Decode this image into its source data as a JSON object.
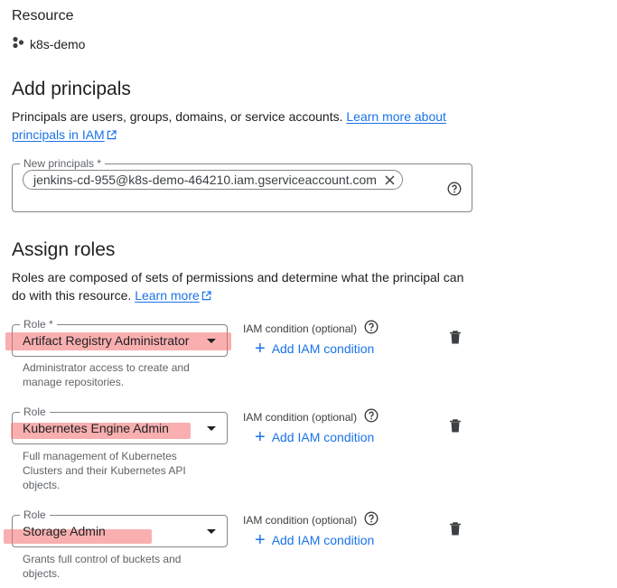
{
  "resource": {
    "heading": "Resource",
    "name": "k8s-demo",
    "icon": "project-nodes-icon"
  },
  "principals": {
    "heading": "Add principals",
    "desc_text": "Principals are users, groups, domains, or service accounts.",
    "desc_link_part1": "Learn more about",
    "desc_link_part2": "principals in IAM",
    "field_label": "New principals *",
    "chip_value": "jenkins-cd-955@k8s-demo-464210.iam.gserviceaccount.com"
  },
  "roles": {
    "heading": "Assign roles",
    "desc_line1": "Roles are composed of sets of permissions and determine what the principal can",
    "desc_line2": "do with this resource.",
    "desc_link": "Learn more",
    "items": [
      {
        "label": "Role *",
        "value": "Artifact Registry Administrator",
        "description_lines": [
          "Administrator access to create and",
          "manage repositories."
        ],
        "iam_condition_label": "IAM condition (optional)",
        "add_condition": "Add IAM condition"
      },
      {
        "label": "Role",
        "value": "Kubernetes Engine Admin",
        "description_lines": [
          "Full management of Kubernetes",
          "Clusters and their Kubernetes API",
          "objects."
        ],
        "iam_condition_label": "IAM condition (optional)",
        "add_condition": "Add IAM condition"
      },
      {
        "label": "Role",
        "value": "Storage Admin",
        "description_lines": [
          "Grants full control of buckets and",
          "objects."
        ],
        "iam_condition_label": "IAM condition (optional)",
        "add_condition": "Add IAM condition"
      }
    ]
  },
  "colors": {
    "link": "#1a73e8",
    "highlight": "#f46e6e",
    "border": "#80868b"
  }
}
